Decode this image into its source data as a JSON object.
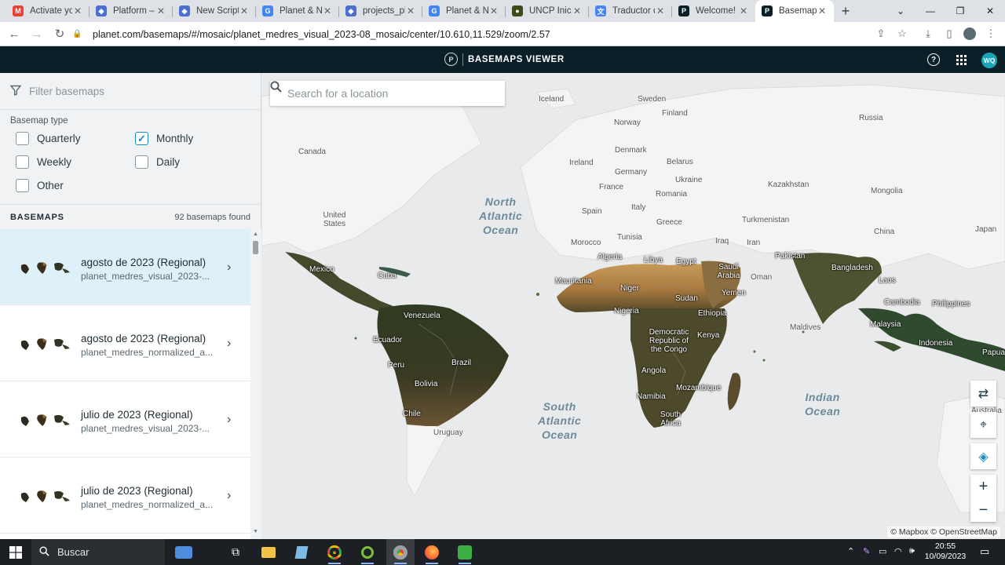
{
  "browser": {
    "tabs": [
      {
        "label": "Activate yo",
        "icon": "gmail-icon",
        "color": "#ea4335",
        "glyph": "M"
      },
      {
        "label": "Platform – G",
        "icon": "earth-engine-icon",
        "color": "#4a6fd1",
        "glyph": "◆"
      },
      {
        "label": "New Script",
        "icon": "earth-engine-icon",
        "color": "#4a6fd1",
        "glyph": "◆"
      },
      {
        "label": "Planet & NI",
        "icon": "google-icon",
        "color": "#4285f4",
        "glyph": "G"
      },
      {
        "label": "projects_pla",
        "icon": "earth-engine-icon",
        "color": "#4a6fd1",
        "glyph": "◆"
      },
      {
        "label": "Planet & NI",
        "icon": "google-icon",
        "color": "#4285f4",
        "glyph": "G"
      },
      {
        "label": "UNCP Inicio",
        "icon": "uncp-icon",
        "color": "#3d4a1a",
        "glyph": "●"
      },
      {
        "label": "Traductor d",
        "icon": "translate-icon",
        "color": "#4285f4",
        "glyph": "文"
      },
      {
        "label": "Welcome!",
        "icon": "planet-icon",
        "color": "#0b1f29",
        "glyph": "P"
      },
      {
        "label": "Basemaps V",
        "icon": "planet-icon",
        "color": "#0b1f29",
        "glyph": "P"
      }
    ],
    "new_tab": "+",
    "url": "planet.com/basemaps/#/mosaic/planet_medres_visual_2023-08_mosaic/center/10.610,11.529/zoom/2.57"
  },
  "app": {
    "title": "BASEMAPS VIEWER",
    "logo_letter": "P",
    "user_initials": "WQ"
  },
  "sidebar": {
    "filter_placeholder": "Filter basemaps",
    "basemap_type_label": "Basemap type",
    "types": [
      {
        "label": "Quarterly",
        "checked": false
      },
      {
        "label": "Monthly",
        "checked": true
      },
      {
        "label": "Weekly",
        "checked": false
      },
      {
        "label": "Daily",
        "checked": false
      },
      {
        "label": "Other",
        "checked": false
      }
    ],
    "basemaps_heading": "BASEMAPS",
    "basemaps_count": "92 basemaps found",
    "items": [
      {
        "title": "agosto de 2023 (Regional)",
        "subtitle": "planet_medres_visual_2023-...",
        "selected": true
      },
      {
        "title": "agosto de 2023 (Regional)",
        "subtitle": "planet_medres_normalized_a...",
        "selected": false
      },
      {
        "title": "julio de 2023 (Regional)",
        "subtitle": "planet_medres_visual_2023-...",
        "selected": false
      },
      {
        "title": "julio de 2023 (Regional)",
        "subtitle": "planet_medres_normalized_a...",
        "selected": false
      }
    ]
  },
  "map": {
    "search_placeholder": "Search for a location",
    "attribution": "© Mapbox © OpenStreetMap",
    "oceans": [
      {
        "name": "North Atlantic Ocean",
        "lines": [
          "North",
          "Atlantic",
          "Ocean"
        ]
      },
      {
        "name": "South Atlantic Ocean",
        "lines": [
          "South",
          "Atlantic",
          "Ocean"
        ]
      },
      {
        "name": "Indian Ocean",
        "lines": [
          "Indian",
          "Ocean"
        ]
      }
    ],
    "places": [
      "Iceland",
      "Sweden",
      "Finland",
      "Russia",
      "Norway",
      "Canada",
      "Denmark",
      "Belarus",
      "Ireland",
      "Germany",
      "France",
      "Ukraine",
      "Kazakhstan",
      "Romania",
      "Mongolia",
      "Spain",
      "Italy",
      "Turkmenistan",
      "Greece",
      "United States",
      "China",
      "Japan",
      "Tunisia",
      "Morocco",
      "Iraq",
      "Iran",
      "Algeria",
      "Libya",
      "Egypt",
      "Pakistan",
      "Saudi Arabia",
      "Oman",
      "Bangladesh",
      "Mexico",
      "Cuba",
      "Mauritania",
      "Niger",
      "Sudan",
      "Laos",
      "Cambodia",
      "Philippines",
      "Yemen",
      "Nigeria",
      "Ethiopia",
      "Venezuela",
      "Malaysia",
      "Maldives",
      "Democratic Republic of the Congo",
      "Kenya",
      "Indonesia",
      "Papua",
      "Ecuador",
      "Brazil",
      "Peru",
      "Angola",
      "Bolivia",
      "Mozambique",
      "Namibia",
      "Chile",
      "South Africa",
      "Australia",
      "Uruguay"
    ]
  },
  "taskbar": {
    "search_label": "Buscar",
    "time": "20:55",
    "date": "10/09/2023"
  }
}
